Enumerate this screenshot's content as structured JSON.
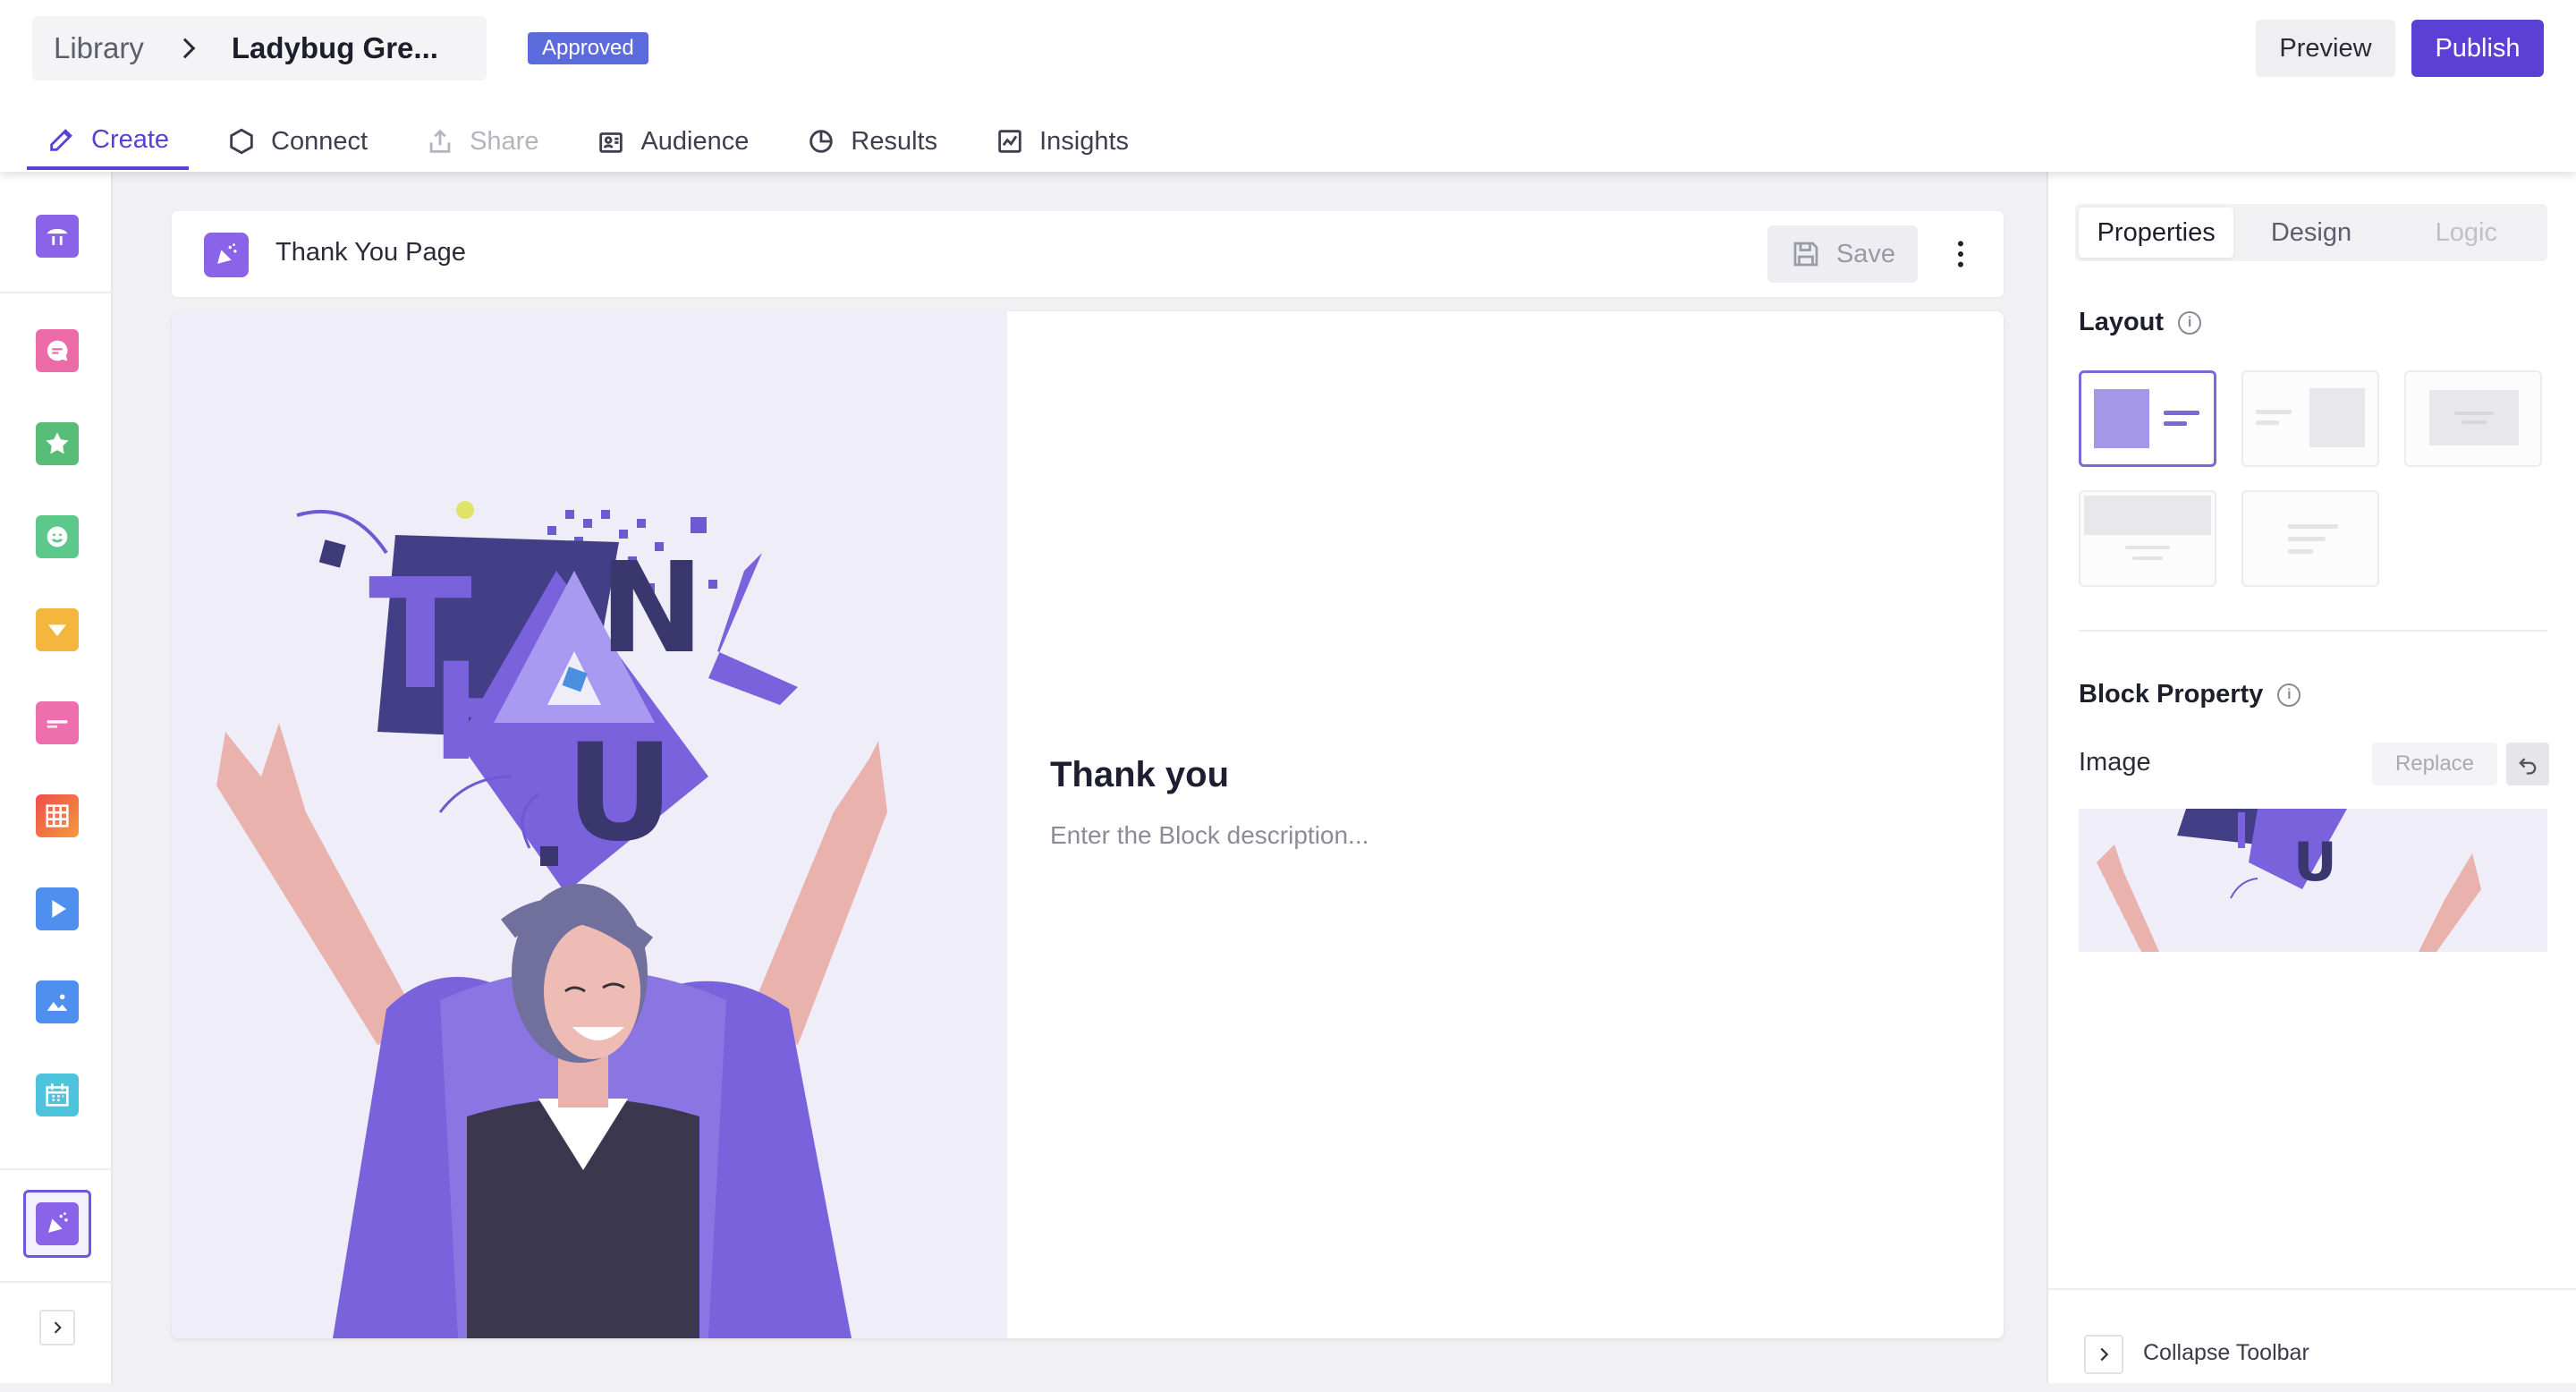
{
  "header": {
    "breadcrumb_root": "Library",
    "breadcrumb_title": "Ladybug Gre...",
    "status_badge": "Approved",
    "preview_label": "Preview",
    "publish_label": "Publish"
  },
  "nav_tabs": [
    {
      "label": "Create",
      "icon": "pencil-icon",
      "state": "active"
    },
    {
      "label": "Connect",
      "icon": "hexagon-icon",
      "state": "normal"
    },
    {
      "label": "Share",
      "icon": "upload-icon",
      "state": "disabled"
    },
    {
      "label": "Audience",
      "icon": "audience-icon",
      "state": "normal"
    },
    {
      "label": "Results",
      "icon": "pie-chart-icon",
      "state": "normal"
    },
    {
      "label": "Insights",
      "icon": "trend-chart-icon",
      "state": "normal"
    }
  ],
  "sidebar": {
    "items": [
      {
        "name": "welcome-block",
        "icon": "welcome-icon",
        "color": "#8a63e8"
      },
      {
        "name": "comment-block",
        "icon": "chat-bubble-icon",
        "color": "#ec6aa8"
      },
      {
        "name": "rating-block",
        "icon": "star-icon",
        "color": "#57bd78"
      },
      {
        "name": "smiley-block",
        "icon": "smiley-icon",
        "color": "#5cc98a"
      },
      {
        "name": "dropdown-block",
        "icon": "dropdown-icon",
        "color": "#f2b73c"
      },
      {
        "name": "text-input-block",
        "icon": "text-input-icon",
        "color": "#ef6fae"
      },
      {
        "name": "matrix-block",
        "icon": "grid-icon",
        "color": "#ef6a3e"
      },
      {
        "name": "video-block",
        "icon": "play-icon",
        "color": "#4f8ff0"
      },
      {
        "name": "image-block",
        "icon": "image-icon",
        "color": "#4f8ff0"
      },
      {
        "name": "date-block",
        "icon": "calendar-icon",
        "color": "#4ec3dc"
      },
      {
        "name": "thank-you-block",
        "icon": "celebration-icon",
        "color": "#8a63e8"
      }
    ]
  },
  "page_bar": {
    "title": "Thank You Page",
    "save_label": "Save"
  },
  "block": {
    "heading": "Thank you",
    "description_placeholder": "Enter the Block description..."
  },
  "right_panel": {
    "tabs": [
      {
        "label": "Properties",
        "state": "active"
      },
      {
        "label": "Design",
        "state": "normal"
      },
      {
        "label": "Logic",
        "state": "disabled"
      }
    ],
    "layout_title": "Layout",
    "block_property_title": "Block Property",
    "image_label": "Image",
    "replace_label": "Replace",
    "collapse_label": "Collapse Toolbar"
  },
  "colors": {
    "accent": "#5b40d6",
    "badge": "#5c6bdc",
    "illustration_bg": "#efedf8"
  }
}
